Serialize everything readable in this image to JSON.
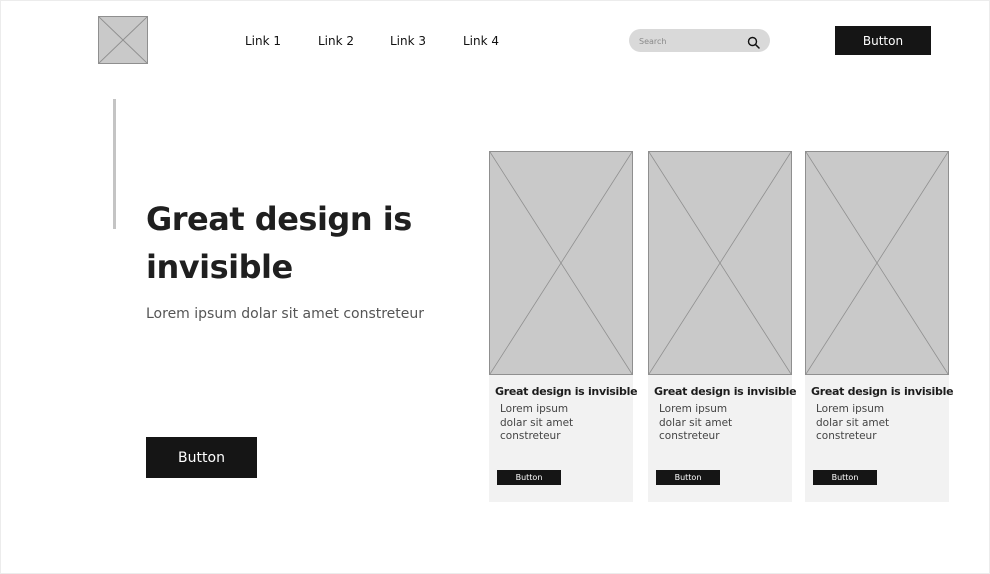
{
  "header": {
    "logo_icon": "image-placeholder-icon",
    "nav": [
      {
        "label": "Link 1"
      },
      {
        "label": "Link 2"
      },
      {
        "label": "Link 3"
      },
      {
        "label": "Link 4"
      }
    ],
    "search": {
      "placeholder": "Search",
      "value": "",
      "icon": "search-icon"
    },
    "button_label": "Button"
  },
  "hero": {
    "title": "Great design is invisible",
    "subtitle": "Lorem ipsum dolar sit amet constreteur",
    "button_label": "Button"
  },
  "cards": [
    {
      "title": "Great design is invisible",
      "text": "Lorem ipsum dolar sit amet constreteur",
      "button_label": "Button",
      "image_icon": "image-placeholder-icon"
    },
    {
      "title": "Great design is invisible",
      "text": "Lorem ipsum dolar sit amet constreteur",
      "button_label": "Button",
      "image_icon": "image-placeholder-icon"
    },
    {
      "title": "Great design is invisible",
      "text": "Lorem ipsum dolar sit amet constreteur",
      "button_label": "Button",
      "image_icon": "image-placeholder-icon"
    }
  ],
  "colors": {
    "background": "#ffffff",
    "button": "#151515",
    "button_text": "#ffffff",
    "placeholder": "#c9c9c9",
    "card_bg": "#f2f2f2",
    "search_bg": "#d9d9d9",
    "accent_bar": "#c4c4c4"
  }
}
